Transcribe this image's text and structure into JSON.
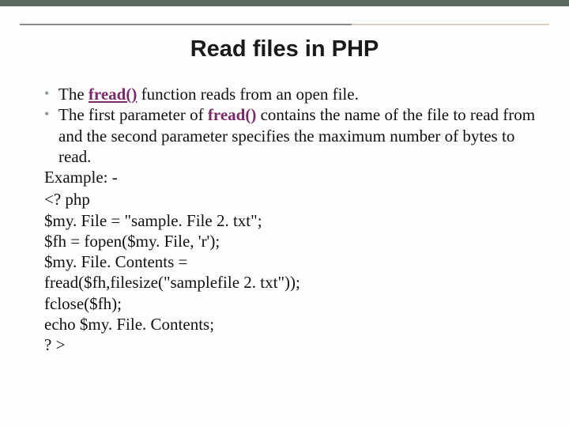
{
  "title": "Read files in PHP",
  "bullets": {
    "b1_pre": "The ",
    "b1_kw": "fread()",
    "b1_post": " function reads from an open file.",
    "b2_pre": "The first parameter of ",
    "b2_kw": "fread()",
    "b2_post": " contains the name of the file to read from and the second parameter specifies the maximum number of bytes to read."
  },
  "example_label": "Example: -",
  "code": {
    "l1": "<? php",
    "l2": "$my. File = \"sample. File 2. txt\";",
    "l3": "$fh = fopen($my. File, 'r');",
    "l4": "$my. File. Contents =",
    "l5": "fread($fh,filesize(\"samplefile 2. txt\"));",
    "l6": "fclose($fh);",
    "l7": "echo $my. File. Contents;",
    "l8": "? >"
  }
}
